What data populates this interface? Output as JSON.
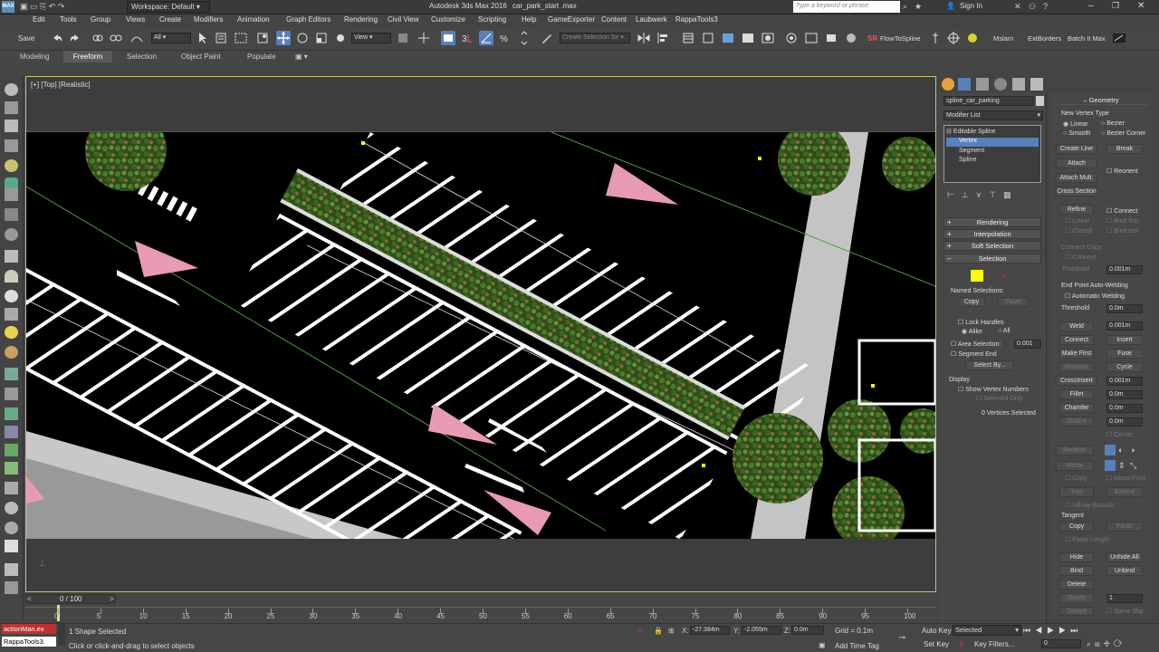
{
  "window": {
    "app_title": "Autodesk 3ds Max 2016",
    "file_name": "car_park_start .max",
    "workspace": "Workspace: Default",
    "search_placeholder": "Type a keyword or phrase",
    "sign_in": "Sign In"
  },
  "menu": [
    "Edit",
    "Tools",
    "Group",
    "Views",
    "Create",
    "Modifiers",
    "Animation",
    "Graph Editors",
    "Rendering",
    "Civil View",
    "Customize",
    "Scripting",
    "Help",
    "GameExporter",
    "Content",
    "Laubwerk",
    "RappaTools3"
  ],
  "toolbar": {
    "save_label": "Save",
    "selection_filter": "All",
    "ref_coord": "View",
    "create_selection_set": "Create Selection Se",
    "script_buttons": [
      "FlowToSpline",
      "Mslam",
      "ExtBorders",
      "Batch It Max"
    ]
  },
  "ribbon_tabs": [
    "Modeling",
    "Freeform",
    "Selection",
    "Object Paint",
    "Populate"
  ],
  "viewport": {
    "label": "[+] [Top] [Realistic]"
  },
  "modify_panel": {
    "object_name": "spline_car_parking",
    "modifier_list": "Modifier List",
    "stack": [
      "Editable Spline",
      "Vertex",
      "Segment",
      "Spline"
    ],
    "rollouts": {
      "rendering": "Rendering",
      "interpolation": "Interpolation",
      "soft_selection": "Soft Selection",
      "selection": "Selection"
    },
    "named_selections": "Named Selections:",
    "copy": "Copy",
    "paste": "Paste",
    "lock_handles": "Lock Handles",
    "alike": "Alike",
    "all": "All",
    "area_selection": "Area Selection:",
    "area_value": "0.001",
    "segment_end": "Segment End",
    "select_by": "Select By...",
    "display": "Display",
    "show_vertex_numbers": "Show Vertex Numbers",
    "selected_only": "Selected Only",
    "vertices_selected": "0 Vertices Selected"
  },
  "geometry_panel": {
    "header": "Geometry",
    "new_vertex_type": "New Vertex Type",
    "linear": "Linear",
    "bezier": "Bezier",
    "smooth": "Smooth",
    "bezier_corner": "Bezier Corner",
    "create_line": "Create Line",
    "break": "Break",
    "attach": "Attach",
    "reorient": "Reorient",
    "attach_mult": "Attach Mult.",
    "cross_section": "Cross Section",
    "refine": "Refine",
    "connect": "Connect",
    "linear2": "Linear",
    "bind_first": "Bind first",
    "closed": "Closed",
    "bind_last": "Bind last",
    "connect_copy": "Connect Copy",
    "connect2": "Connect",
    "threshold": "Threshold",
    "threshold_val": "0.001m",
    "end_point": "End Point Auto-Welding",
    "automatic_welding": "Automatic Welding",
    "threshold2": "Threshold",
    "threshold2_val": "0.0m",
    "weld": "Weld",
    "weld_val": "0.001m",
    "connect3": "Connect",
    "insert": "Insert",
    "make_first": "Make First",
    "fuse": "Fuse",
    "reverse": "Reverse",
    "cycle": "Cycle",
    "crossinsert": "CrossInsert",
    "crossinsert_val": "0.001m",
    "fillet": "Fillet",
    "fillet_val": "0.0m",
    "chamfer": "Chamfer",
    "chamfer_val": "0.0m",
    "outline": "Outline",
    "outline_val": "0.0m",
    "center": "Center",
    "boolean": "Boolean",
    "mirror": "Mirror",
    "copy": "Copy",
    "about_pivot": "About Pivot",
    "trim": "Trim",
    "extend": "Extend",
    "infinite_bounds": "Infinite Bounds",
    "tangent": "Tangent",
    "tcopy": "Copy",
    "tpaste": "Paste",
    "paste_length": "Paste Length",
    "hide": "Hide",
    "unhide_all": "Unhide All",
    "bind": "Bind",
    "unbind": "Unbind",
    "delete": "Delete",
    "divide": "Divide",
    "divide_val": "1",
    "detach": "Detach",
    "same_shp": "Same Shp"
  },
  "timeline": {
    "frame": "0 / 100",
    "ticks": [
      "0",
      "5",
      "10",
      "15",
      "20",
      "25",
      "30",
      "35",
      "40",
      "45",
      "50",
      "55",
      "60",
      "65",
      "70",
      "75",
      "80",
      "85",
      "90",
      "95",
      "100"
    ]
  },
  "status": {
    "maxscript1": "actionMan.ex",
    "maxscript2": "RappaTools3.",
    "selected": "1 Shape Selected",
    "prompt": "Click or click-and-drag to select objects",
    "x_label": "X:",
    "x_val": "-27.384m",
    "y_label": "Y:",
    "y_val": "-2.055m",
    "z_label": "Z:",
    "z_val": "0.0m",
    "grid": "Grid = 0.1m",
    "add_time_tag": "Add Time Tag",
    "auto_key": "Auto Key",
    "auto_key_mode": "Selected",
    "set_key": "Set Key",
    "key_filters": "Key Filters...",
    "frame_val": "0"
  },
  "colors": {
    "accent": "#5681b9",
    "viewport_border": "#c8c36a",
    "marker_pink": "#e89ab4",
    "plant_green": "#3f6b24"
  }
}
